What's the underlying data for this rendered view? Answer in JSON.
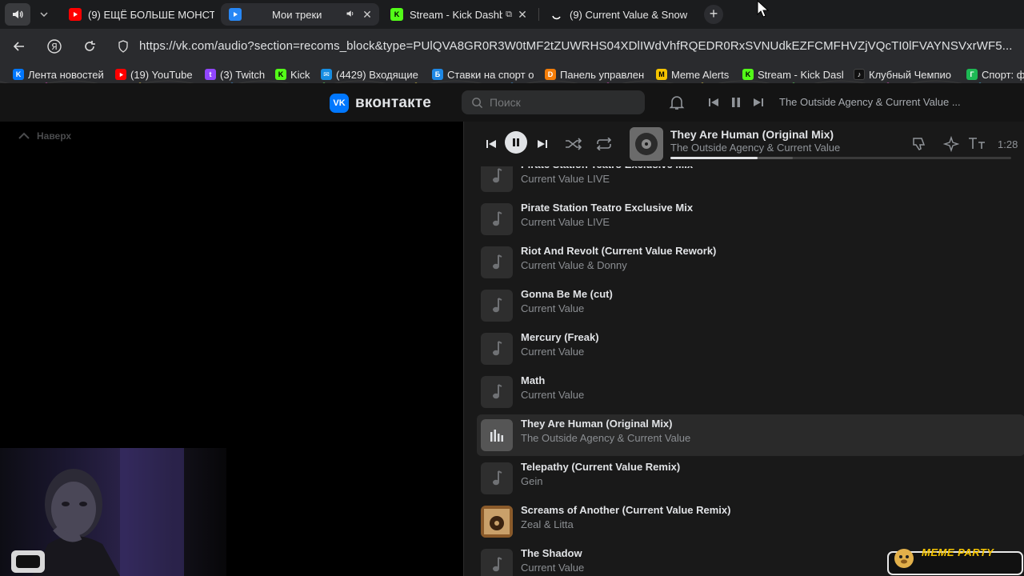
{
  "browser": {
    "tabs": [
      {
        "title": "(9) ЕЩЁ БОЛЬШЕ МОНСТ",
        "favicon": "youtube-icon",
        "color": "#ff0000"
      },
      {
        "title": "Мои треки",
        "favicon": "vk-music-icon",
        "color": "#2787f5",
        "active": true
      },
      {
        "title": "Stream - Kick Dashbo",
        "favicon": "kick-icon",
        "color": "#53fc18"
      },
      {
        "title": "(9) Current Value & Snow",
        "favicon": "loading-icon",
        "color": "#ffffff"
      }
    ],
    "url": "https://vk.com/audio?section=recoms_block&type=PUlQVA8GR0R3W0tMF2tZUWRHS04XDlIWdVhfRQEDR0RxSVNUdkEZFCMFHVZjVQcTI0lFVAYNSVxrWF5...",
    "bookmarks": [
      {
        "label": "Лента новостей",
        "icon": "vk-icon",
        "color": "#0077ff"
      },
      {
        "label": "(19) YouTube",
        "icon": "youtube-icon",
        "color": "#ff0000"
      },
      {
        "label": "(3) Twitch",
        "icon": "twitch-icon",
        "color": "#9146ff"
      },
      {
        "label": "Kick",
        "icon": "kick-icon",
        "color": "#53fc18"
      },
      {
        "label": "(4429) Входящие",
        "icon": "mail-icon",
        "color": "#168de2"
      },
      {
        "label": "Ставки на спорт о",
        "icon": "betting-icon",
        "color": "#1e88e5"
      },
      {
        "label": "Панель управлен",
        "icon": "donation-icon",
        "color": "#f57d07"
      },
      {
        "label": "Meme Alerts",
        "icon": "memealerts-icon",
        "color": "#f5c400"
      },
      {
        "label": "Stream - Kick Dash",
        "icon": "kick-icon",
        "color": "#53fc18"
      },
      {
        "label": "Клубный Чемпио",
        "icon": "tiktok-icon",
        "color": "#111111"
      },
      {
        "label": "Спорт: фу",
        "icon": "sport-icon",
        "color": "#1db954"
      }
    ]
  },
  "vk": {
    "logo_text": "вконтакте",
    "search_placeholder": "Поиск",
    "header_track": "The Outside Agency & Current Value ...",
    "up_button": "Наверх",
    "accent": "#0077ff"
  },
  "player": {
    "title": "They Are Human (Original Mix)",
    "artist": "The Outside Agency & Current Value",
    "time": "1:28",
    "progress": 0.255,
    "buffered": 0.36
  },
  "tracks": [
    {
      "title": "Pirate Station Teatro Exclusive Mix",
      "artist": "Current Value LIVE"
    },
    {
      "title": "Pirate Station Teatro Exclusive Mix",
      "artist": "Current Value LIVE"
    },
    {
      "title": "Riot And Revolt (Current Value Rework)",
      "artist": "Current Value & Donny"
    },
    {
      "title": "Gonna Be Me (cut)",
      "artist": "Current Value"
    },
    {
      "title": "Mercury (Freak)",
      "artist": "Current Value"
    },
    {
      "title": "Math",
      "artist": "Current Value"
    },
    {
      "title": "They Are Human (Original Mix)",
      "artist": "The Outside Agency & Current Value",
      "playing": true
    },
    {
      "title": "Telepathy (Current Value Remix)",
      "artist": "Gein"
    },
    {
      "title": "Screams of Another (Current Value Remix)",
      "artist": "Zeal & Litta",
      "cover": true
    },
    {
      "title": "The Shadow",
      "artist": "Current Value"
    }
  ],
  "overlay": {
    "meme_label": "MEME PARTY"
  }
}
